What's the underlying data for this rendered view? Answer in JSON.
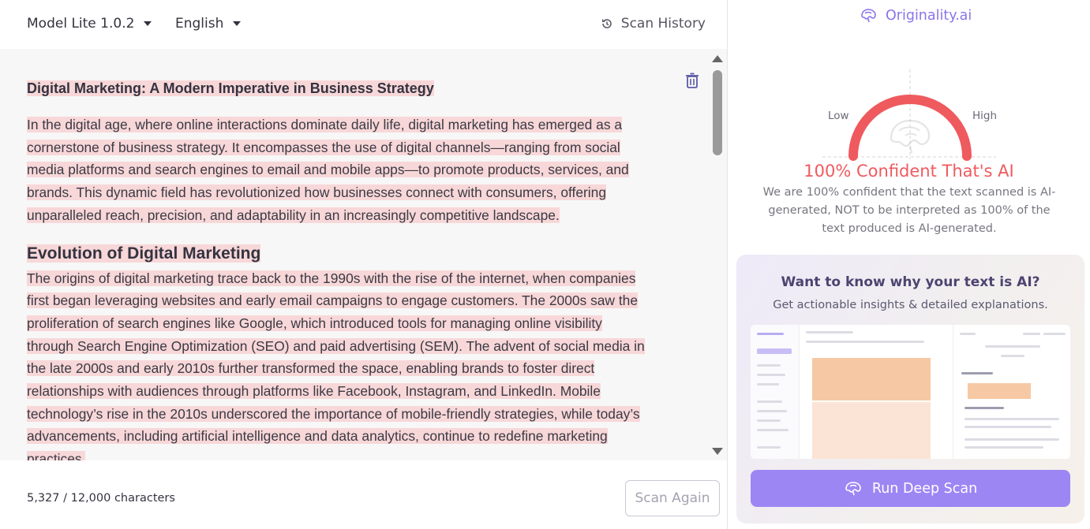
{
  "toolbar": {
    "model_label": "Model Lite 1.0.2",
    "language_label": "English",
    "history_label": "Scan History"
  },
  "document": {
    "title": "Digital Marketing: A Modern Imperative in Business Strategy",
    "para1": "In the digital age, where online interactions dominate daily life, digital marketing has emerged as a cornerstone of business strategy. It encompasses the use of digital channels—ranging from social media platforms and search engines to email and mobile apps—to promote products, services, and brands. This dynamic field has revolutionized how businesses connect with consumers, offering unparalleled reach, precision, and adaptability in an increasingly competitive landscape.",
    "heading2": "Evolution of Digital Marketing",
    "para2": "The origins of digital marketing trace back to the 1990s with the rise of the internet, when companies first began leveraging websites and early email campaigns to engage customers. The 2000s saw the proliferation of search engines like Google, which introduced tools for managing online visibility through Search Engine Optimization (SEO) and paid advertising (SEM). The advent of social media in the late 2000s and early 2010s further transformed the space, enabling brands to foster direct relationships with audiences through platforms like Facebook, Instagram, and LinkedIn. Mobile technology’s rise in the 2010s underscored the importance of mobile-friendly strategies, while today’s advancements, including artificial intelligence and data analytics, continue to redefine marketing practices."
  },
  "footer": {
    "char_count": "5,327 / 12,000 characters",
    "scan_again_label": "Scan Again"
  },
  "result": {
    "brand": "Originality.ai",
    "gauge_low": "Low",
    "gauge_high": "High",
    "confidence_score": 100,
    "headline": "100% Confident That's AI",
    "explanation": "We are 100% confident that the text scanned is AI-generated, NOT to be interpreted as 100% of the text produced is AI-generated."
  },
  "promo": {
    "title": "Want to know why your text is AI?",
    "subtitle": "Get actionable insights & detailed explanations.",
    "button_label": "Run Deep Scan"
  },
  "colors": {
    "highlight": "#f8d7d8",
    "accent": "#9c86f4",
    "ai_red": "#ef5a5f"
  },
  "icons": {
    "history": "history-icon",
    "trash": "trash-icon",
    "brain": "brain-icon"
  }
}
